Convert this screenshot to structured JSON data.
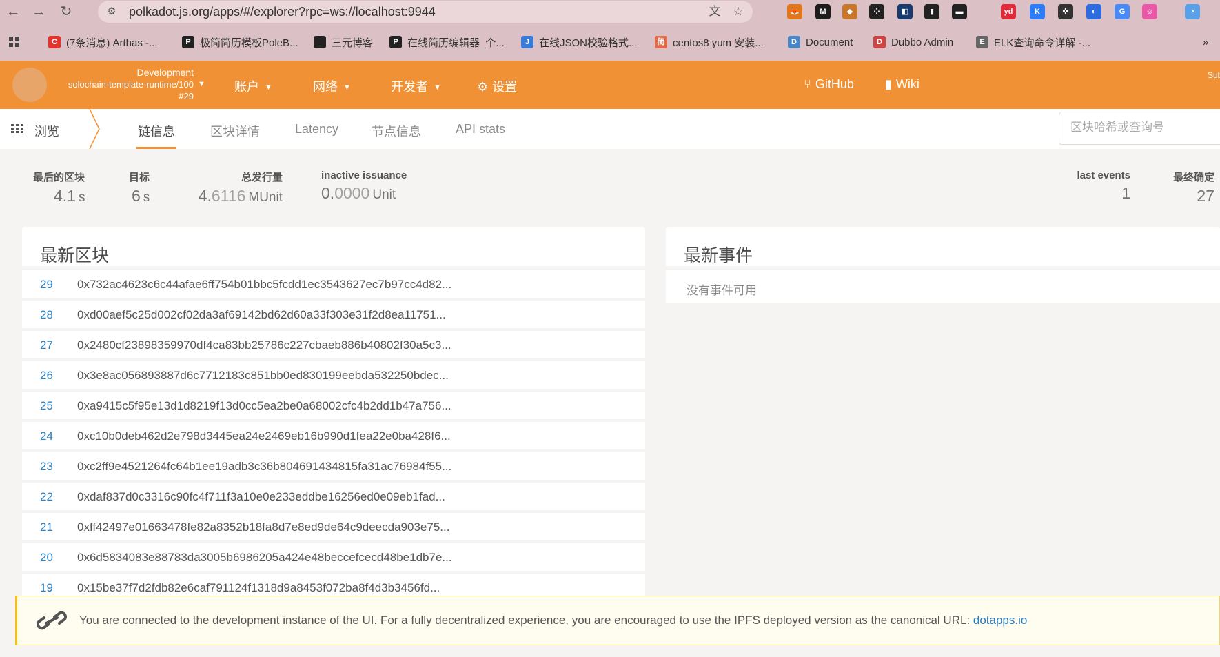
{
  "browser": {
    "url": "polkadot.js.org/apps/#/explorer?rpc=ws://localhost:9944",
    "bookmarks": [
      {
        "label": "(7条消息) Arthas -...",
        "icon": "C",
        "color": "#e0342c"
      },
      {
        "label": "极简简历模板PoleB...",
        "icon": "P",
        "color": "#222222"
      },
      {
        "label": "三元博客",
        "icon": "reco",
        "color": "#222222"
      },
      {
        "label": "在线简历编辑器_个...",
        "icon": "P",
        "color": "#222222"
      },
      {
        "label": "在线JSON校验格式...",
        "icon": "J",
        "color": "#3a7bd5"
      },
      {
        "label": "centos8 yum 安装...",
        "icon": "简",
        "color": "#e06a4a"
      },
      {
        "label": "Document",
        "icon": "D",
        "color": "#4a86c5"
      },
      {
        "label": "Dubbo Admin",
        "icon": "D",
        "color": "#c44"
      },
      {
        "label": "ELK查询命令详解 -...",
        "icon": "E",
        "color": "#666666"
      }
    ],
    "extensions": [
      {
        "icon": "fox-icon",
        "color": "#e2761b"
      },
      {
        "icon": "mz-icon",
        "color": "#1d1d1d"
      },
      {
        "icon": "arrow-icon",
        "color": "#c8762b"
      },
      {
        "icon": "dots-icon",
        "color": "#222222"
      },
      {
        "icon": "doc-icon",
        "color": "#1a3a6e"
      },
      {
        "icon": "chart-icon",
        "color": "#222222"
      },
      {
        "icon": "terminal-icon",
        "color": "#222222"
      },
      {
        "icon": "yd-icon",
        "color": "#e02a3a"
      },
      {
        "icon": "k-icon",
        "color": "#2d7cf6"
      },
      {
        "icon": "target-icon",
        "color": "#333333"
      },
      {
        "icon": "swirl-icon",
        "color": "#2d6cdf"
      },
      {
        "icon": "translate-icon",
        "color": "#4a8af4"
      },
      {
        "icon": "octo-icon",
        "color": "#e85aa8"
      },
      {
        "icon": "badge-icon",
        "color": "#5aa0e8"
      }
    ],
    "badge_count": "1"
  },
  "header": {
    "chain_env": "Development",
    "chain_runtime": "solochain-template-runtime/100",
    "chain_block": "#29",
    "menu": {
      "accounts": "账户",
      "network": "网络",
      "developer": "开发者",
      "settings": "设置",
      "github": "GitHub",
      "wiki": "Wiki"
    },
    "sub": "Sub",
    "brand_color": "#f19135"
  },
  "tabs": {
    "browse": "浏览",
    "chain_info": "链信息",
    "block_details": "区块详情",
    "latency": "Latency",
    "node_info": "节点信息",
    "api_stats": "API stats",
    "search_placeholder": "区块哈希或查询号"
  },
  "stats": {
    "last_block_label": "最后的区块",
    "last_block_value": "4.1",
    "last_block_unit": "s",
    "target_label": "目标",
    "target_value": "6",
    "target_unit": "s",
    "total_issuance_label": "总发行量",
    "total_issuance_int": "4.",
    "total_issuance_dec": "6116",
    "total_issuance_unit": "MUnit",
    "inactive_label": "inactive issuance",
    "inactive_int": "0.",
    "inactive_dec": "0000",
    "inactive_unit": "Unit",
    "last_events_label": "last events",
    "last_events_value": "1",
    "finalized_label": "最终确定",
    "finalized_value": "27"
  },
  "recent_blocks": {
    "title": "最新区块",
    "rows": [
      {
        "number": "29",
        "hash": "0x732ac4623c6c44afae6ff754b01bbc5fcdd1ec3543627ec7b97cc4d82..."
      },
      {
        "number": "28",
        "hash": "0xd00aef5c25d002cf02da3af69142bd62d60a33f303e31f2d8ea11751..."
      },
      {
        "number": "27",
        "hash": "0x2480cf23898359970df4ca83bb25786c227cbaeb886b40802f30a5c3..."
      },
      {
        "number": "26",
        "hash": "0x3e8ac056893887d6c7712183c851bb0ed830199eebda532250bdec..."
      },
      {
        "number": "25",
        "hash": "0xa9415c5f95e13d1d8219f13d0cc5ea2be0a68002cfc4b2dd1b47a756..."
      },
      {
        "number": "24",
        "hash": "0xc10b0deb462d2e798d3445ea24e2469eb16b990d1fea22e0ba428f6..."
      },
      {
        "number": "23",
        "hash": "0xc2ff9e4521264fc64b1ee19adb3c36b804691434815fa31ac76984f55..."
      },
      {
        "number": "22",
        "hash": "0xdaf837d0c3316c90fc4f711f3a10e0e233eddbe16256ed0e09eb1fad..."
      },
      {
        "number": "21",
        "hash": "0xff42497e01663478fe82a8352b18fa8d7e8ed9de64c9deecda903e75..."
      },
      {
        "number": "20",
        "hash": "0x6d5834083e88783da3005b6986205a424e48beccefcecd48be1db7e..."
      },
      {
        "number": "19",
        "hash": "0x15be37f7d2fdb82e6caf791124f1318d9a8453f072ba8f4d3b3456fd..."
      }
    ]
  },
  "recent_events": {
    "title": "最新事件",
    "empty": "没有事件可用"
  },
  "notice": {
    "text": "You are connected to the development instance of the UI. For a fully decentralized experience, you are encouraged to use the IPFS deployed version as the canonical URL: ",
    "link": "dotapps.io"
  }
}
